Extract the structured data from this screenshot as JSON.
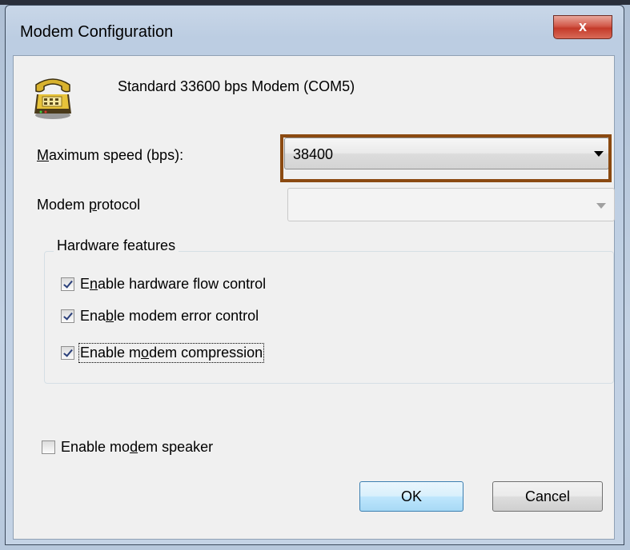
{
  "dialog": {
    "title": "Modem Configuration",
    "close_label": "x",
    "modem_name": "Standard 33600 bps Modem (COM5)"
  },
  "fields": {
    "max_speed": {
      "label_pre": "",
      "label_mnemonic": "M",
      "label_post": "aximum speed (bps):",
      "value": "38400"
    },
    "protocol": {
      "label_pre": "Modem ",
      "label_mnemonic": "p",
      "label_post": "rotocol",
      "value": ""
    }
  },
  "hardware": {
    "title": "Hardware features",
    "options": [
      {
        "pre": "E",
        "mnemonic": "n",
        "post": "able hardware flow control",
        "checked": true
      },
      {
        "pre": "Ena",
        "mnemonic": "b",
        "post": "le modem error control",
        "checked": true
      },
      {
        "pre": "Enable m",
        "mnemonic": "o",
        "post": "dem compression",
        "checked": true
      }
    ]
  },
  "speaker": {
    "pre": "Enable mo",
    "mnemonic": "d",
    "post": "em speaker",
    "checked": false
  },
  "buttons": {
    "ok": "OK",
    "cancel": "Cancel"
  },
  "colors": {
    "highlight": "#8b4a11",
    "close_button": "#c43a2a"
  }
}
